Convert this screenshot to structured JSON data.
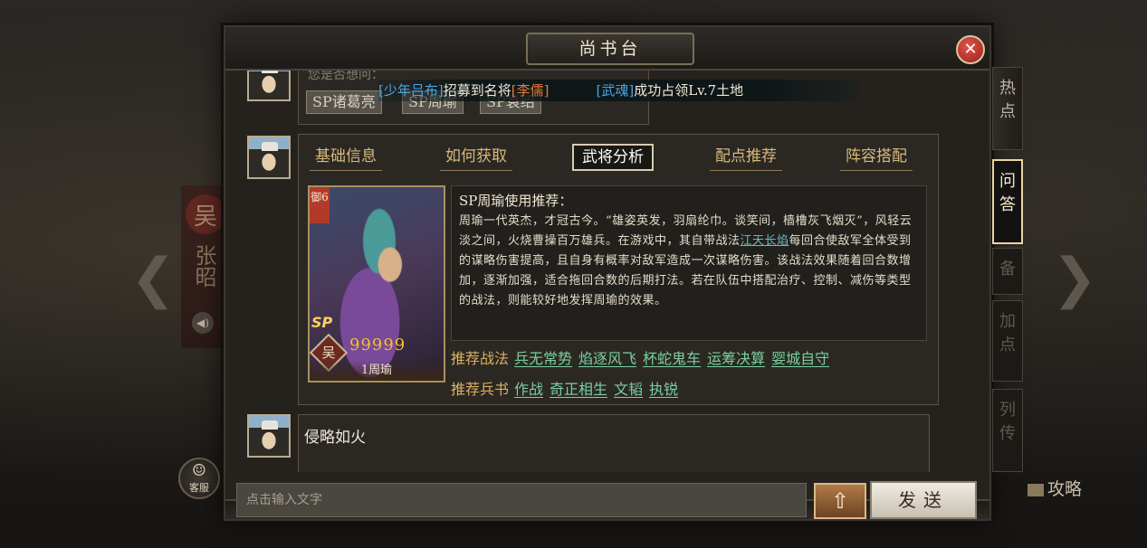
{
  "dialog": {
    "title": "尚书台",
    "close": "✕"
  },
  "background": {
    "left_seal": "吴",
    "left_name": "张昭",
    "speaker_icon": "◀)",
    "nav_left": "❮",
    "nav_right": "❯",
    "gonglue": "攻略"
  },
  "kefu": {
    "icon": "☺",
    "label": "客服"
  },
  "broadcast": {
    "p1_open": "[",
    "p1_name": "少年吕布",
    "p1_close": "]",
    "p1_text": "招募到名将",
    "p1_hero_open": "[",
    "p1_hero": "李儒",
    "p1_hero_close": "]",
    "p2_open": "[",
    "p2_name": "武魂",
    "p2_close": "]",
    "p2_text": "成功占领Lv.7土地"
  },
  "messages": {
    "msg1": {
      "text": "您是否想问：",
      "chips": [
        "SP诸葛亮",
        "SP周瑜",
        "SP袁绍"
      ]
    },
    "msg2": {
      "tabs": [
        "基础信息",
        "如何获取",
        "武将分析",
        "配点推荐",
        "阵容搭配"
      ],
      "active_tab": "武将分析",
      "card": {
        "tag": "御6",
        "sp": "SP",
        "faction": "吴",
        "stars": "99999",
        "name": "1周瑜"
      },
      "rec_title": "SP周瑜使用推荐：",
      "rec_body_1": "周瑜一代英杰，才冠古今。“雄姿英发，羽扇纶巾。谈笑间，樯橹灰飞烟灭”，风轻云淡之间，火烧曹操百万雄兵。在游戏中，其自带战法",
      "rec_skill": "江天长焰",
      "rec_body_2": "每回合使敌军全体受到的谋略伤害提高，且自身有概率对敌军造成一次谋略伤害。该战法效果随着回合数增加，逐渐加强，适合拖回合数的后期打法。若在队伍中搭配治疗、控制、减伤等类型的战法，则能较好地发挥周瑜的效果。",
      "tactics_label": "推荐战法",
      "tactics": [
        "兵无常势",
        "焰逐风飞",
        "杯蛇鬼车",
        "运筹决算",
        "婴城自守"
      ],
      "books_label": "推荐兵书",
      "books": [
        "作战",
        "奇正相生",
        "文韬",
        "执锐"
      ]
    },
    "msg3": {
      "text": "侵略如火"
    }
  },
  "input": {
    "placeholder": "点击输入文字",
    "up": "⇧",
    "send": "发送"
  },
  "side_tabs": [
    {
      "label": "热点",
      "state": "normal"
    },
    {
      "label": "问答",
      "state": "active"
    },
    {
      "label": "备",
      "state": "dim"
    },
    {
      "label": "加点",
      "state": "dim"
    },
    {
      "label": "列传",
      "state": "dim"
    }
  ],
  "colors": {
    "accent_gold": "#d8b060",
    "link_green": "#7acfa0",
    "skill_blue": "#6ab8c8",
    "player_blue": "#47a6e0",
    "hero_orange": "#e27a3a",
    "close_red": "#c0342a"
  }
}
